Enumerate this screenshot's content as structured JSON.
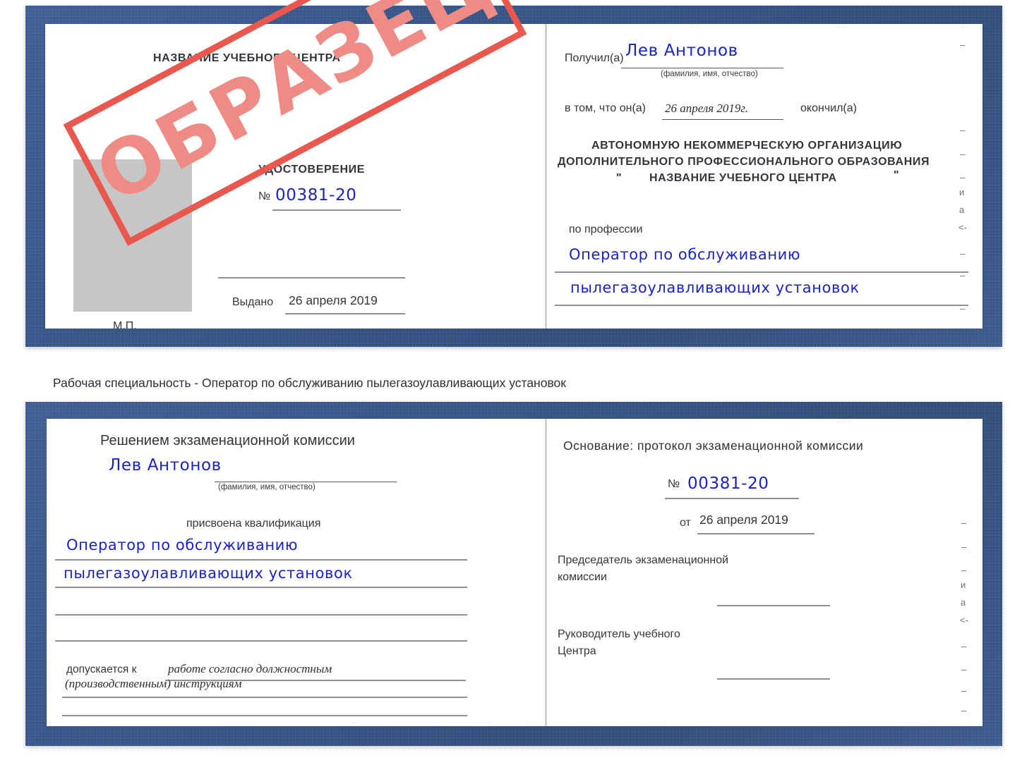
{
  "caption": "Рабочая специальность - Оператор по обслуживанию пылегазоулавливающих установок",
  "watermark": {
    "text": "ОБРАЗЕЦ",
    "color": "#ef8b85",
    "border_color": "#e8584f"
  },
  "colors": {
    "cover_blue": "#234a88",
    "ink_blue": "#1a23c8",
    "text_gray": "#32363a",
    "rule_gray": "#8e9297",
    "photo_placeholder": "#c6c6c6"
  },
  "certificate_top": {
    "left_page": {
      "org_title": "НАЗВАНИЕ УЧЕБНОГО ЦЕНТРА",
      "doc_type": "УДОСТОВЕРЕНИЕ",
      "number_prefix": "№",
      "number_value": "00381-20",
      "issued_label": "Выдано",
      "issued_value": "26 апреля 2019",
      "stamp_label": "М.П.",
      "photo_placeholder": "photo-box"
    },
    "right_page": {
      "received_label": "Получил(а)",
      "received_value": "Лев Антонов",
      "fio_hint": "(фамилия, имя, отчество)",
      "that_label": "в том, что он(а)",
      "completion_date": "26 апреля 2019г.",
      "finished_label": "окончил(а)",
      "org_line1": "АВТОНОМНУЮ НЕКОММЕРЧЕСКУЮ ОРГАНИЗАЦИЮ",
      "org_line2": "ДОПОЛНИТЕЛЬНОГО ПРОФЕССИОНАЛЬНОГО ОБРАЗОВАНИЯ",
      "org_quote_open": "\"",
      "org_line3": "НАЗВАНИЕ УЧЕБНОГО ЦЕНТРА",
      "org_quote_close": "\"",
      "profession_label": "по профессии",
      "profession_line1": "Оператор по обслуживанию",
      "profession_line2": "пылегазоулавливающих установок",
      "bleed_marks": [
        "–",
        "–",
        "–",
        "и",
        "а",
        "<-",
        "–",
        "–",
        "–",
        "–"
      ]
    }
  },
  "certificate_bottom": {
    "left_page": {
      "decision_title": "Решением экзаменационной комиссии",
      "name_value": "Лев Антонов",
      "fio_hint": "(фамилия, имя, отчество)",
      "qualification_label": "присвоена квалификация",
      "qualification_line1": "Оператор по обслуживанию",
      "qualification_line2": "пылегазоулавливающих установок",
      "admitted_label": "допускается к",
      "admitted_value_line1": "работе согласно должностным",
      "admitted_value_line2": "(производственным) инструкциям"
    },
    "right_page": {
      "basis_label": "Основание: протокол экзаменационной комиссии",
      "number_prefix": "№",
      "number_value": "00381-20",
      "date_prefix": "от",
      "date_value": "26 апреля 2019",
      "chairman_line1": "Председатель экзаменационной",
      "chairman_line2": "комиссии",
      "head_line1": "Руководитель учебного",
      "head_line2": "Центра",
      "bleed_marks": [
        "–",
        "–",
        "–",
        "и",
        "а",
        "<-",
        "–",
        "–",
        "–",
        "–"
      ]
    }
  }
}
